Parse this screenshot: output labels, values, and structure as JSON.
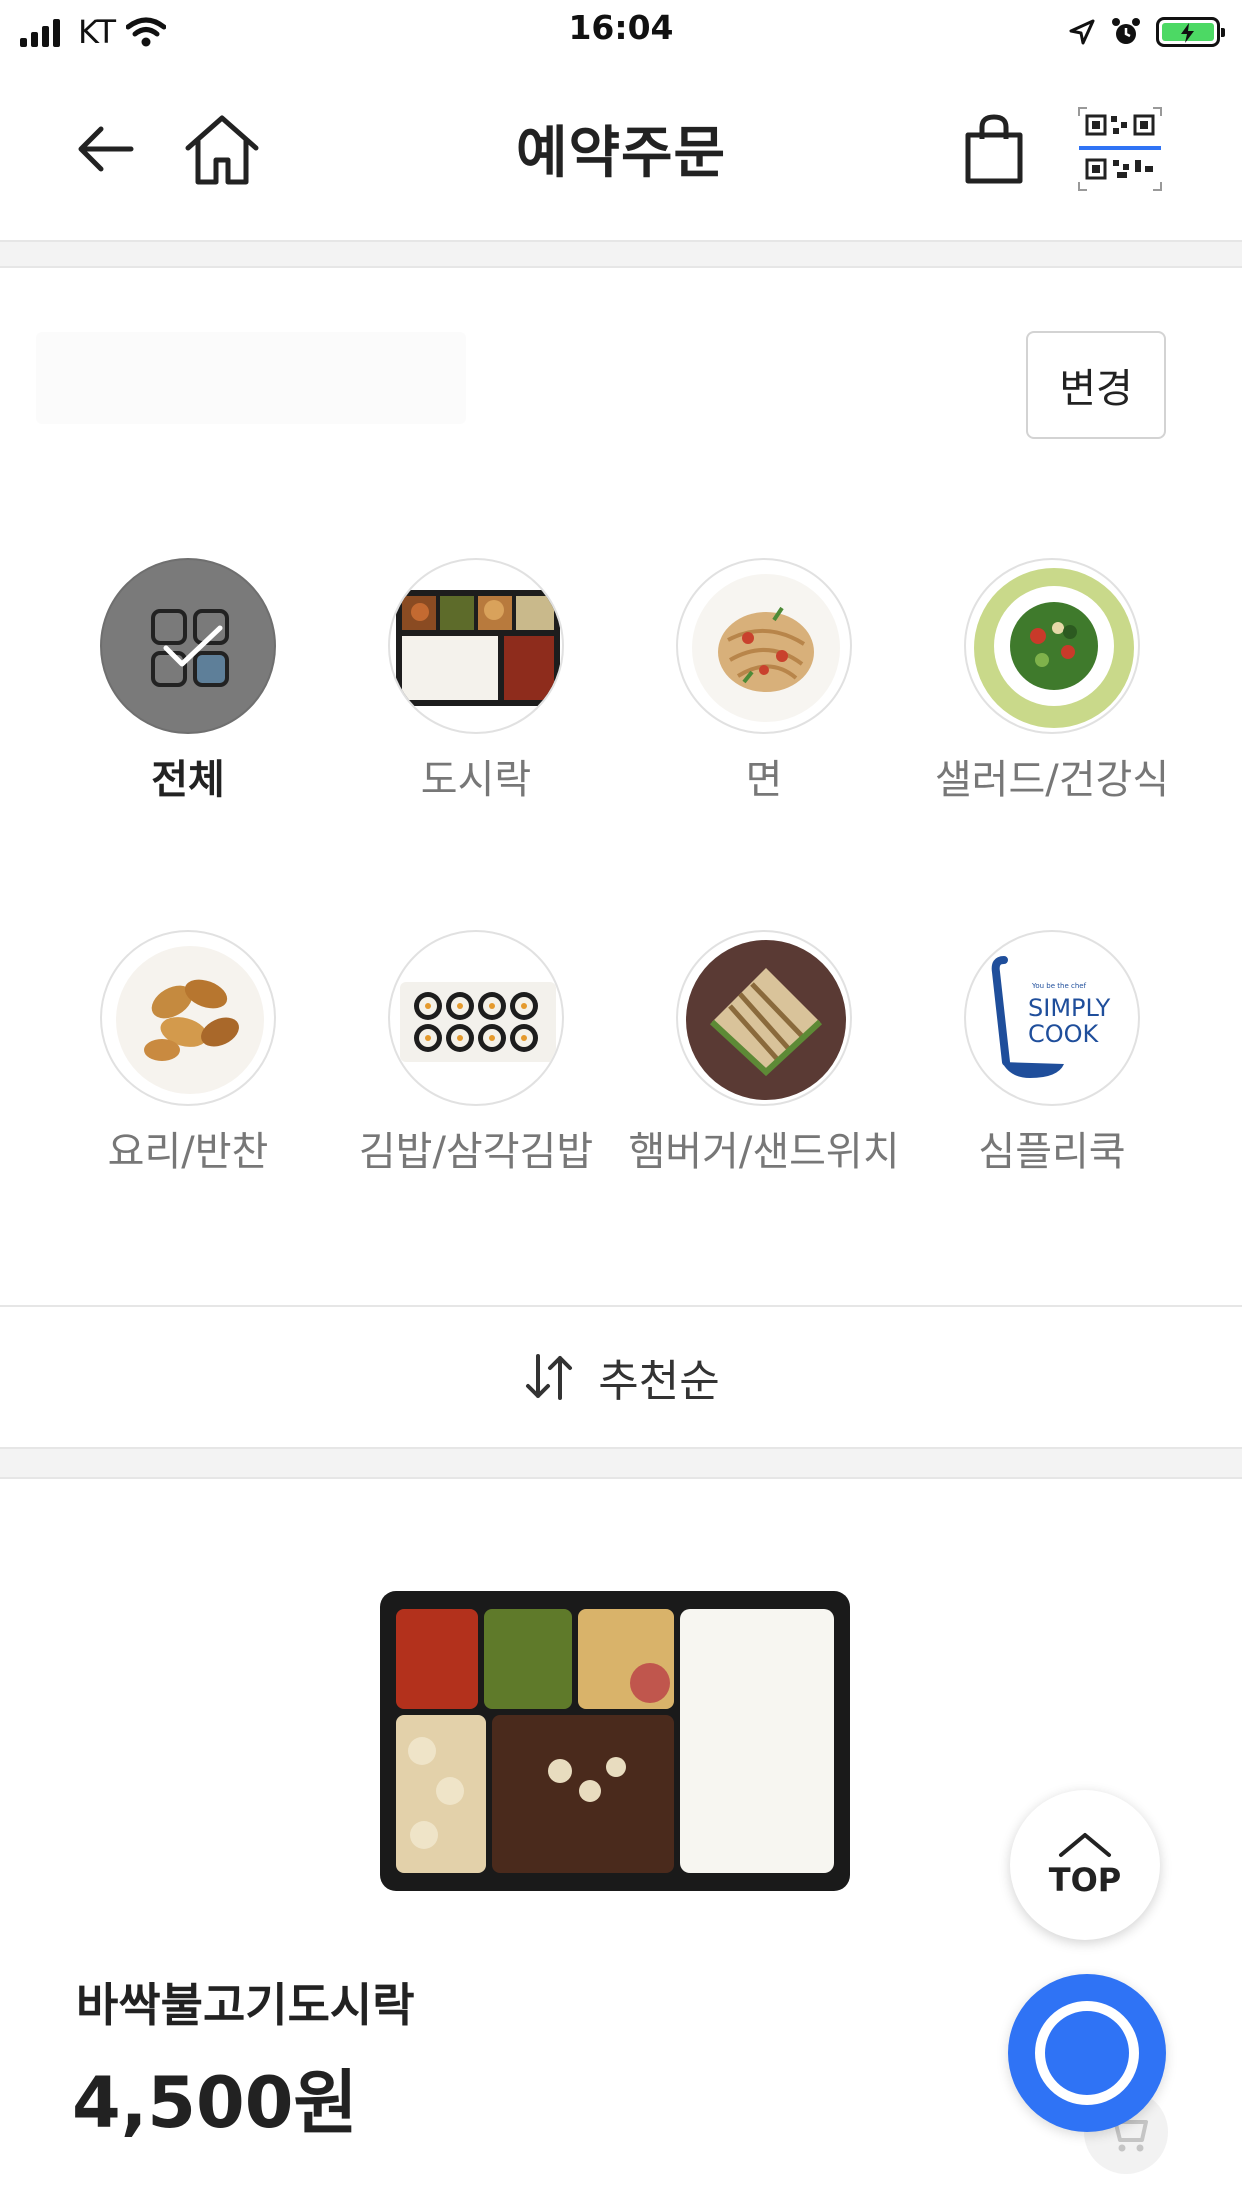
{
  "status_bar": {
    "carrier": "KT",
    "time": "16:04",
    "battery_charging": true
  },
  "header": {
    "title": "예약주문",
    "icons": [
      "back-arrow-icon",
      "home-icon",
      "shopping-bag-icon",
      "qr-code-icon"
    ]
  },
  "store": {
    "change_label": "변경"
  },
  "categories": [
    {
      "label": "전체",
      "selected": true
    },
    {
      "label": "도시락",
      "selected": false
    },
    {
      "label": "면",
      "selected": false
    },
    {
      "label": "샐러드/건강식",
      "selected": false
    },
    {
      "label": "요리/반찬",
      "selected": false
    },
    {
      "label": "김밥/삼각김밥",
      "selected": false
    },
    {
      "label": "햄버거/샌드위치",
      "selected": false
    },
    {
      "label": "심플리쿡",
      "selected": false
    }
  ],
  "simply_cook_logo": {
    "tagline": "You be the chef",
    "line1": "SIMPLY",
    "line2": "COOK"
  },
  "sort": {
    "label": "추천순",
    "icon": "sort-arrows-icon"
  },
  "product": {
    "name": "바싹불고기도시락",
    "price": "4,500원"
  },
  "floating": {
    "top_label": "TOP"
  },
  "colors": {
    "accent_blue": "#2f73f5",
    "selected_gray": "#7a7a7a",
    "battery_green": "#4cd964"
  }
}
